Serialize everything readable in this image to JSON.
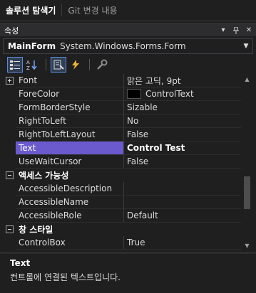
{
  "tabs": [
    {
      "label": "솔루션 탐색기"
    },
    {
      "label": "Git 변경 내용"
    }
  ],
  "panel": {
    "title": "속성"
  },
  "object_selector": {
    "name": "MainForm",
    "type": "System.Windows.Forms.Form"
  },
  "toolbar": {
    "buttons": [
      {
        "icon": "categorized-icon",
        "checked": true
      },
      {
        "icon": "alphabetical-icon",
        "checked": false
      },
      {
        "icon": "properties-icon",
        "checked": true
      },
      {
        "icon": "events-icon",
        "checked": false
      },
      {
        "icon": "property-pages-icon",
        "checked": false
      }
    ]
  },
  "rows": [
    {
      "name": "Font",
      "value": "맑은 고딕, 9pt",
      "expandable": true
    },
    {
      "name": "ForeColor",
      "value": "ControlText",
      "swatch": "#000000"
    },
    {
      "name": "FormBorderStyle",
      "value": "Sizable"
    },
    {
      "name": "RightToLeft",
      "value": "No"
    },
    {
      "name": "RightToLeftLayout",
      "value": "False"
    },
    {
      "name": "Text",
      "value": "Control Test",
      "selected": true
    },
    {
      "name": "UseWaitCursor",
      "value": "False"
    }
  ],
  "category_accessibility": {
    "label": "액세스 가능성",
    "rows": [
      {
        "name": "AccessibleDescription",
        "value": ""
      },
      {
        "name": "AccessibleName",
        "value": ""
      },
      {
        "name": "AccessibleRole",
        "value": "Default"
      }
    ]
  },
  "category_window_style": {
    "label": "창 스타일",
    "rows": [
      {
        "name": "ControlBox",
        "value": "True"
      }
    ]
  },
  "description": {
    "title": "Text",
    "text": "컨트롤에 연결된 텍스트입니다."
  },
  "colors": {
    "selection": "#6a5acd",
    "background": "#1f1f1f",
    "header": "#2d2d30"
  }
}
